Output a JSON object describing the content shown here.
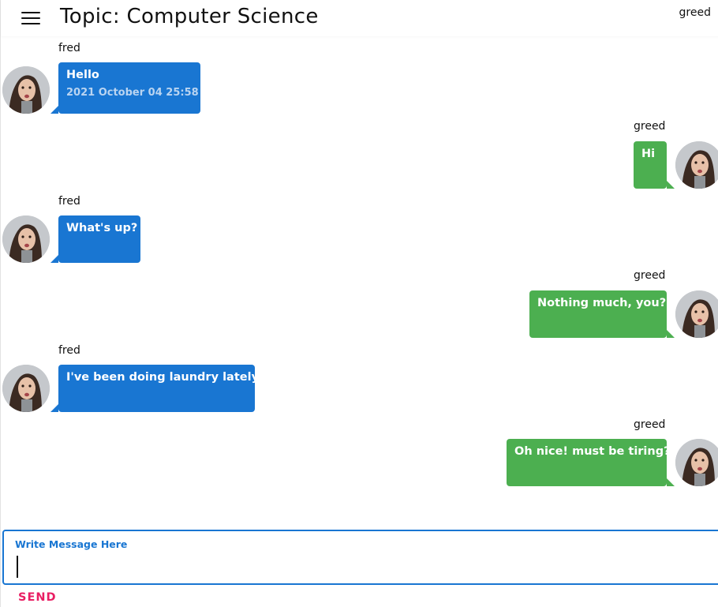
{
  "header": {
    "title": "Topic: Computer Science",
    "current_user": "greed"
  },
  "messages": [
    {
      "sender": "fred",
      "text": "Hello",
      "timestamp": "2021 October 04 25:58"
    },
    {
      "sender": "greed",
      "text": "Hi"
    },
    {
      "sender": "fred",
      "text": "What's up?"
    },
    {
      "sender": "greed",
      "text": "Nothing much, you?"
    },
    {
      "sender": "fred",
      "text": "I've been doing laundry lately"
    },
    {
      "sender": "greed",
      "text": "Oh nice! must be tiring?"
    }
  ],
  "composer": {
    "label": "Write Message Here",
    "value": "",
    "send_label": "SEND"
  },
  "icons": {
    "menu": "hamburger-menu-icon",
    "avatar": "user-avatar"
  },
  "colors": {
    "incoming_bubble": "#1976d2",
    "outgoing_bubble": "#4caf50",
    "accent": "#1976d2",
    "send": "#e91e63"
  }
}
